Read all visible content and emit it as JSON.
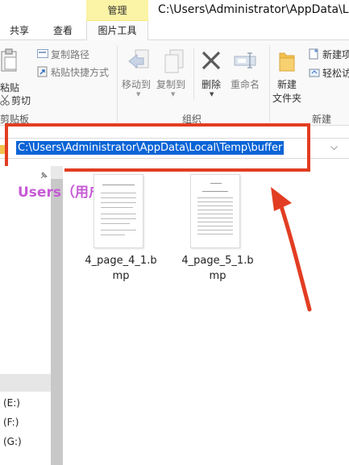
{
  "window": {
    "title": "C:\\Users\\Administrator\\AppData\\Lo",
    "context_tab": "管理"
  },
  "ribbon_tabs": [
    "共享",
    "查看",
    "图片工具"
  ],
  "ribbon": {
    "clipboard": {
      "paste": "粘贴",
      "copy_path": "复制路径",
      "paste_shortcut": "粘贴快捷方式",
      "cut": "剪切",
      "group": "剪贴板"
    },
    "organize": {
      "move_to": "移动到",
      "copy_to": "复制到",
      "delete": "删除",
      "rename": "重命名",
      "group": "组织"
    },
    "new": {
      "new_folder_line1": "新建",
      "new_folder_line2": "文件夹",
      "new_item": "新建项",
      "easy_access": "轻松访",
      "group": "新建"
    }
  },
  "address_bar": {
    "path": "C:\\Users\\Administrator\\AppData\\Local\\Temp\\buffer"
  },
  "annotation": {
    "label": "Users（用户）",
    "color": "#e23d22",
    "label_color": "#c659d6"
  },
  "nav": {
    "drives": [
      "(E:)",
      "(F:)",
      "(G:)"
    ]
  },
  "files": [
    {
      "name_line1": "4_page_4_1.b",
      "name_line2": "mp"
    },
    {
      "name_line1": "4_page_5_1.b",
      "name_line2": "mp"
    }
  ],
  "colors": {
    "context_tab_bg": "#fbf3a6",
    "selection_blue": "#0a64d6",
    "folder_yellow": "#f2c14e"
  }
}
